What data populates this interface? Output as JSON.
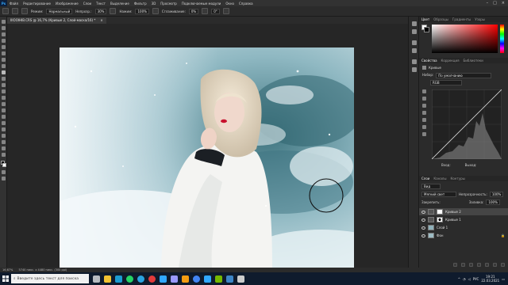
{
  "app": {
    "logo": "Ps"
  },
  "menu": [
    "Файл",
    "Редактирование",
    "Изображение",
    "Слои",
    "Текст",
    "Выделение",
    "Фильтр",
    "3D",
    "Просмотр",
    "Подключаемые модули",
    "Окно",
    "Справка"
  ],
  "options": {
    "mode_label": "Режим:",
    "mode_value": "Нормальный",
    "opacity_label": "Непрозр.:",
    "opacity_value": "30%",
    "flow_label": "Нажим:",
    "flow_value": "100%",
    "smooth_label": "Сглаживание:",
    "smooth_value": "0%",
    "angle_value": "0°"
  },
  "document_tab": {
    "title": "IIIOOIHIB.CRS @ 16,7% (Кривые 2, Слой-маска/16) *",
    "close": "×"
  },
  "panels": {
    "color_tabs": [
      "Цвет",
      "Образцы",
      "Градиенты",
      "Узоры"
    ],
    "props_tabs": [
      "Свойства",
      "Коррекция",
      "Библиотеки"
    ],
    "props_title": "Кривые",
    "preset_label": "Набор:",
    "preset_value": "По умолчанию",
    "channel_value": "RGB",
    "input_label": "Вход:",
    "output_label": "Выход:",
    "layers_tabs": [
      "Слои",
      "Каналы",
      "Контуры"
    ],
    "kind_value": "Вид",
    "blend_value": "Мягкий свет",
    "opacity_label": "Непрозрачность:",
    "opacity_value": "100%",
    "lock_label": "Закрепить:",
    "fill_label": "Заливка:",
    "fill_value": "100%",
    "layers": [
      {
        "name": "Кривые 2"
      },
      {
        "name": "Кривые 1"
      },
      {
        "name": "Слой 1"
      },
      {
        "name": "Фон"
      }
    ]
  },
  "status": {
    "zoom": "16,67%",
    "info": "5740 пикс. x 4480 пикс. (300 ppi)"
  },
  "taskbar": {
    "search_placeholder": "Введите здесь текст для поиска",
    "lang": "РУС",
    "time": "19:21",
    "date": "22.03.2021"
  },
  "colors": {
    "accent": "#31a8ff",
    "panel_bg": "#2b2b2b",
    "canvas_bg": "#262626",
    "taskbar": "#0f1b2d"
  }
}
